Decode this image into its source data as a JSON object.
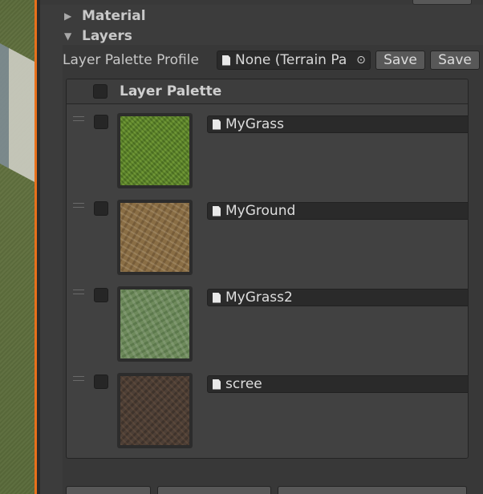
{
  "foldouts": {
    "material": {
      "label": "Material",
      "expanded": false
    },
    "layers": {
      "label": "Layers",
      "expanded": true
    }
  },
  "profile": {
    "label": "Layer Palette Profile",
    "value": "None (Terrain Pa",
    "save_label": "Save",
    "save_as_label": "Save"
  },
  "palette": {
    "title": "Layer Palette",
    "layers": [
      {
        "name": "MyGrass",
        "texture": "grass"
      },
      {
        "name": "MyGround",
        "texture": "ground"
      },
      {
        "name": "MyGrass2",
        "texture": "grass2"
      },
      {
        "name": "scree",
        "texture": "scree"
      }
    ]
  },
  "colors": {
    "accent_edge": "#e8701b",
    "panel_bg": "#3c3c3c"
  }
}
